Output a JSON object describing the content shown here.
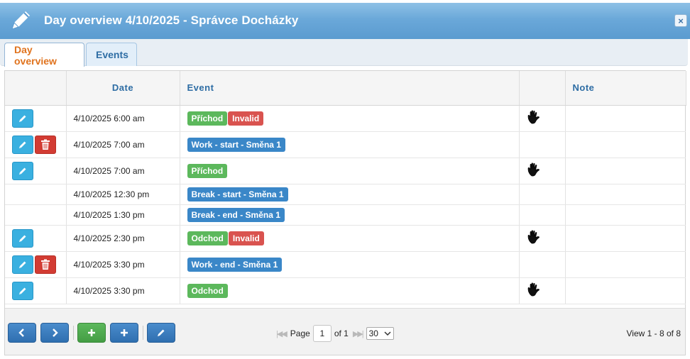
{
  "window": {
    "title": "Day overview 4/10/2025 - Správce Docházky",
    "close_label": "×"
  },
  "tabs": [
    {
      "label": "Day overview",
      "active": true
    },
    {
      "label": "Events",
      "active": false
    }
  ],
  "table": {
    "columns": [
      "",
      "Date",
      "Event",
      "",
      "Note"
    ],
    "rows": [
      {
        "edit": true,
        "delete": false,
        "date": "4/10/2025 6:00 am",
        "events": [
          {
            "text": "Příchod",
            "color": "#5cb85c"
          },
          {
            "text": "Invalid",
            "color": "#d9534f"
          }
        ],
        "manual": true,
        "note": ""
      },
      {
        "edit": true,
        "delete": true,
        "date": "4/10/2025 7:00 am",
        "events": [
          {
            "text": "Work - start - Směna 1",
            "color": "#3a87c8"
          }
        ],
        "manual": false,
        "note": ""
      },
      {
        "edit": true,
        "delete": false,
        "date": "4/10/2025 7:00 am",
        "events": [
          {
            "text": "Příchod",
            "color": "#5cb85c"
          }
        ],
        "manual": true,
        "note": ""
      },
      {
        "edit": false,
        "delete": false,
        "date": "4/10/2025 12:30 pm",
        "events": [
          {
            "text": "Break - start - Směna 1",
            "color": "#3a87c8"
          }
        ],
        "manual": false,
        "note": ""
      },
      {
        "edit": false,
        "delete": false,
        "date": "4/10/2025 1:30 pm",
        "events": [
          {
            "text": "Break - end - Směna 1",
            "color": "#3a87c8"
          }
        ],
        "manual": false,
        "note": ""
      },
      {
        "edit": true,
        "delete": false,
        "date": "4/10/2025 2:30 pm",
        "events": [
          {
            "text": "Odchod",
            "color": "#5cb85c"
          },
          {
            "text": "Invalid",
            "color": "#d9534f"
          }
        ],
        "manual": true,
        "note": ""
      },
      {
        "edit": true,
        "delete": true,
        "date": "4/10/2025 3:30 pm",
        "events": [
          {
            "text": "Work - end - Směna 1",
            "color": "#3a87c8"
          }
        ],
        "manual": false,
        "note": ""
      },
      {
        "edit": true,
        "delete": false,
        "date": "4/10/2025 3:30 pm",
        "events": [
          {
            "text": "Odchod",
            "color": "#5cb85c"
          }
        ],
        "manual": true,
        "note": ""
      }
    ]
  },
  "pager": {
    "page_label": "Page",
    "page_value": "1",
    "of_label": "of 1",
    "page_size": "30",
    "view_info": "View 1 - 8 of 8",
    "buttons": [
      "chevron-left-icon",
      "chevron-right-icon",
      "plus-icon",
      "plus-icon",
      "pencil-icon"
    ]
  },
  "colors": {
    "accent": "#2e6da4",
    "active_tab": "#e0731e"
  }
}
